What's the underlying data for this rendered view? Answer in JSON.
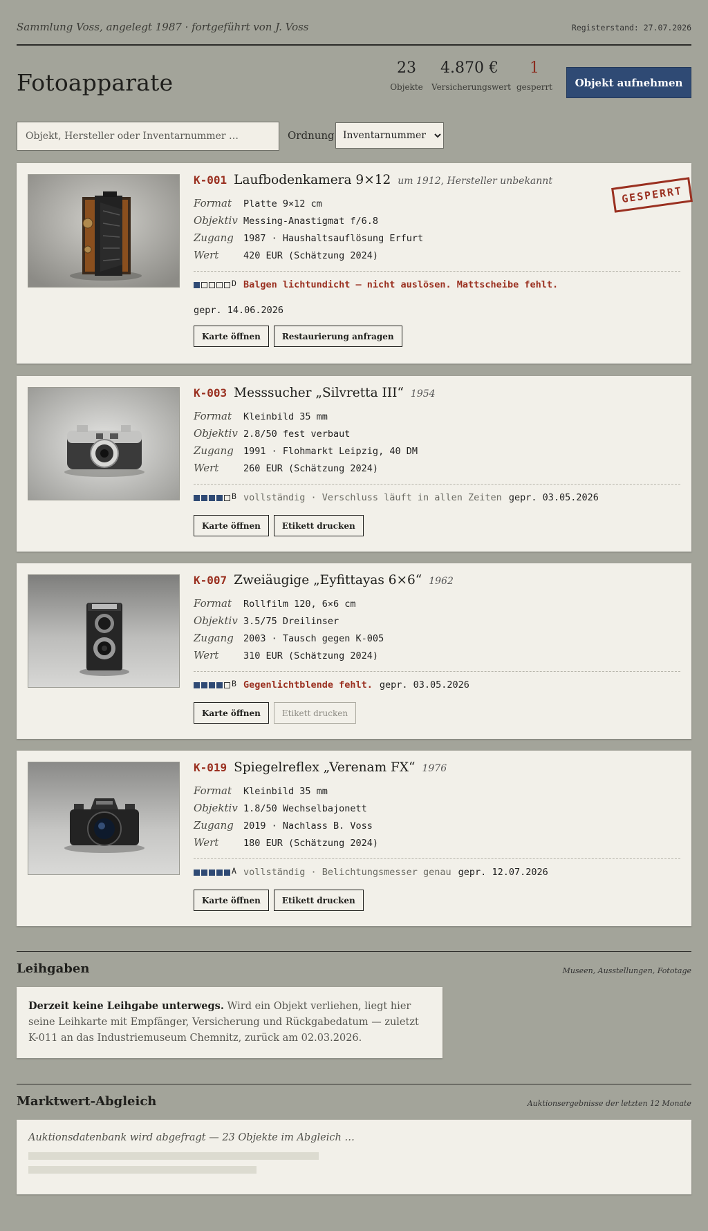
{
  "header": {
    "collection": "Sammlung Voss, angelegt 1987 · fortgeführt von J. Voss",
    "register_date": "Registerstand: 27.07.2026",
    "title": "Fotoapparate",
    "stats": [
      {
        "value": "23",
        "label": "Objekte"
      },
      {
        "value": "4.870 €",
        "label": "Versicherungswert"
      },
      {
        "value": "1",
        "label": "gesperrt"
      }
    ],
    "add_button": "Objekt aufnehmen"
  },
  "search": {
    "placeholder": "Objekt, Hersteller oder Inventarnummer …",
    "order_label": "Ordnung",
    "order_value": "Inventarnummer"
  },
  "accent_colors": {
    "blue": "#2f4a74",
    "red": "#9a3020",
    "background": "#a3a49a",
    "card": "#f2f0e9"
  },
  "items": [
    {
      "inv": "K-001",
      "name": "Laufbodenkamera 9×12",
      "year": "um 1912, Hersteller unbekannt",
      "specs": [
        {
          "k": "Format",
          "v": "Platte 9×12 cm"
        },
        {
          "k": "Objektiv",
          "v": "Messing-Anastigmat f/6.8"
        },
        {
          "k": "Zugang",
          "v": "1987 · Haushaltsauflösung Erfurt"
        },
        {
          "k": "Wert",
          "v": "420 EUR (Schätzung 2024)"
        }
      ],
      "condition_filled": 1,
      "grade": "D",
      "note": "Balgen lichtundicht — nicht auslösen. Mattscheibe fehlt.",
      "checked": "gepr. 14.06.2026",
      "actions": [
        "Karte öffnen",
        "Restaurierung anfragen"
      ],
      "stamp": "GESPERRT",
      "photo_icon": "folding-camera"
    },
    {
      "inv": "K-003",
      "name": "Messsucher „Silvretta III“",
      "year": "1954",
      "specs": [
        {
          "k": "Format",
          "v": "Kleinbild 35 mm"
        },
        {
          "k": "Objektiv",
          "v": "2.8/50 fest verbaut"
        },
        {
          "k": "Zugang",
          "v": "1991 · Flohmarkt Leipzig, 40 DM"
        },
        {
          "k": "Wert",
          "v": "260 EUR (Schätzung 2024)"
        }
      ],
      "condition_filled": 4,
      "grade": "B",
      "note": "vollständig · Verschluss läuft in allen Zeiten",
      "checked": "gepr. 03.05.2026",
      "actions": [
        "Karte öffnen",
        "Etikett drucken"
      ],
      "photo_icon": "rangefinder-camera"
    },
    {
      "inv": "K-007",
      "name": "Zweiäugige „Eyfittayas 6×6“",
      "year": "1962",
      "specs": [
        {
          "k": "Format",
          "v": "Rollfilm 120, 6×6 cm"
        },
        {
          "k": "Objektiv",
          "v": "3.5/75 Dreilinser"
        },
        {
          "k": "Zugang",
          "v": "2003 · Tausch gegen K-005"
        },
        {
          "k": "Wert",
          "v": "310 EUR (Schätzung 2024)"
        }
      ],
      "condition_filled": 4,
      "grade": "B",
      "note": "Gegenlichtblende fehlt.",
      "checked": "gepr. 03.05.2026",
      "actions": [
        "Karte öffnen",
        "Etikett drucken"
      ],
      "photo_icon": "twin-lens-camera"
    },
    {
      "inv": "K-019",
      "name": "Spiegelreflex „Verenam FX“",
      "year": "1976",
      "specs": [
        {
          "k": "Format",
          "v": "Kleinbild 35 mm"
        },
        {
          "k": "Objektiv",
          "v": "1.8/50 Wechselbajonett"
        },
        {
          "k": "Zugang",
          "v": "2019 · Nachlass B. Voss"
        },
        {
          "k": "Wert",
          "v": "180 EUR (Schätzung 2024)"
        }
      ],
      "condition_filled": 5,
      "grade": "A",
      "note": "vollständig · Belichtungsmesser genau",
      "checked": "gepr. 12.07.2026",
      "actions": [
        "Karte öffnen",
        "Etikett drucken"
      ],
      "photo_icon": "slr-camera"
    }
  ],
  "loans": {
    "title": "Leihgaben",
    "subtitle": "Museen, Ausstellungen, Fototage",
    "lead": "Derzeit keine Leihgabe unterwegs.",
    "text": " Wird ein Objekt verliehen, liegt hier seine Leihkarte mit Empfänger, Versicherung und Rückgabedatum — zuletzt K-011 an das Industriemuseum Chemnitz, zurück am 02.03.2026."
  },
  "market": {
    "title": "Marktwert-Abgleich",
    "subtitle": "Auktionsergebnisse der letzten 12 Monate",
    "message": "Auktionsdatenbank wird abgefragt — 23 Objekte im Abgleich …"
  }
}
